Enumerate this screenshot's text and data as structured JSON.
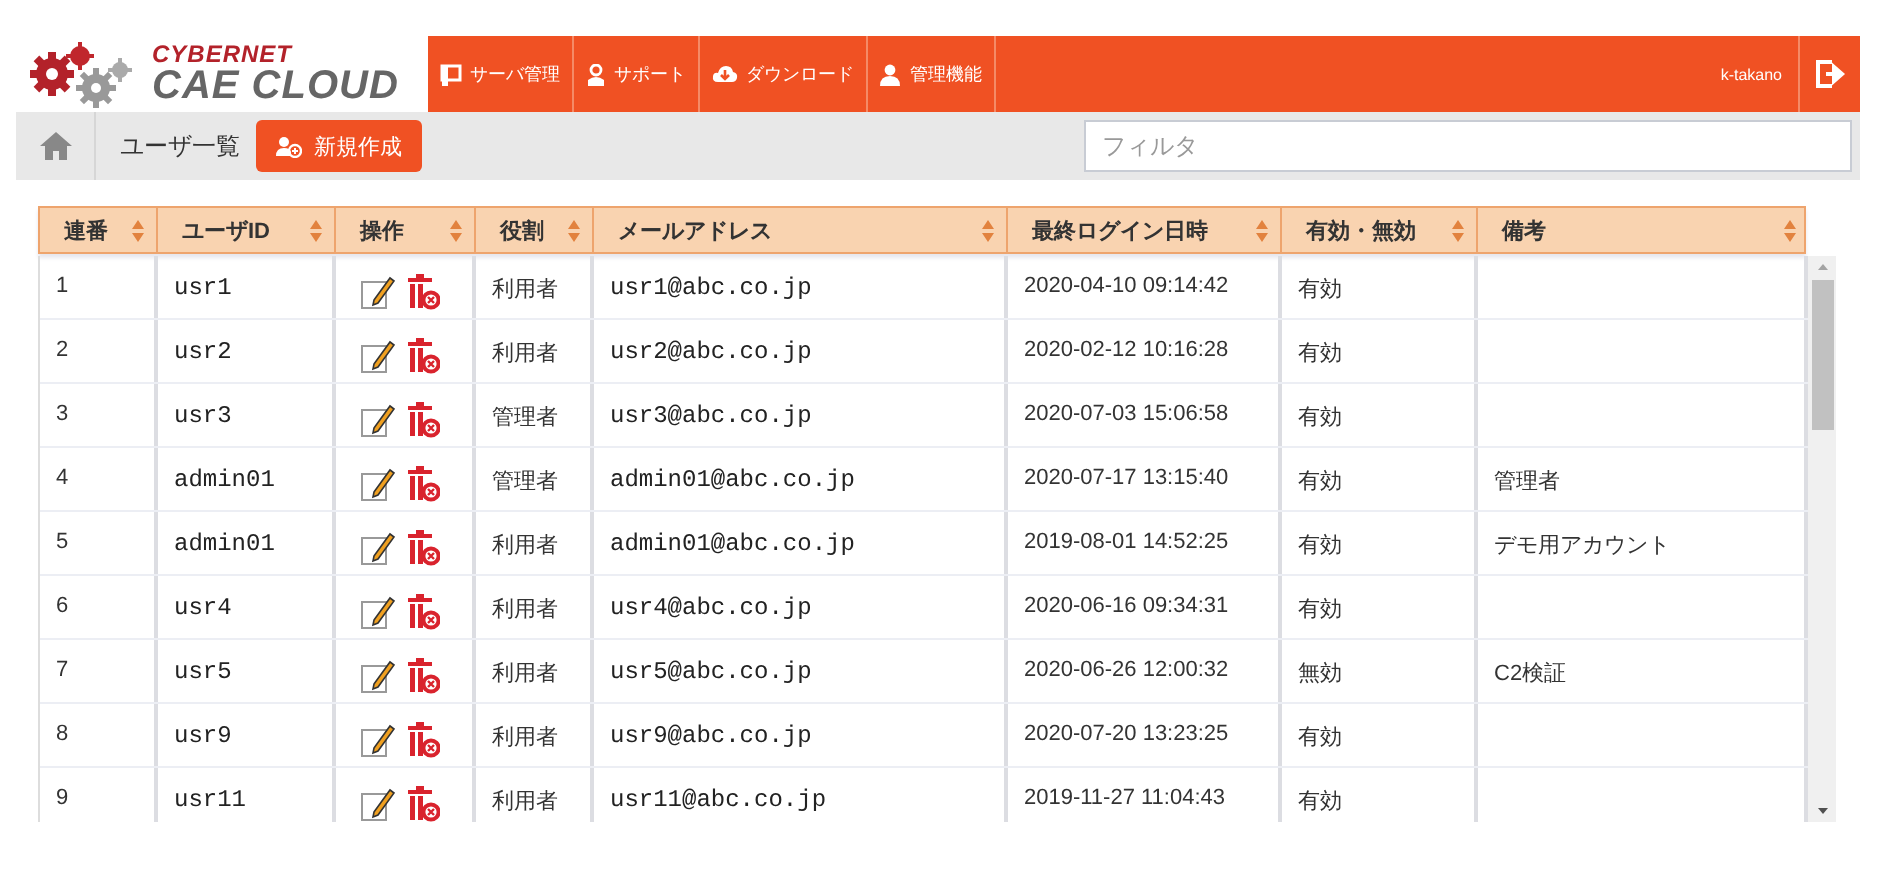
{
  "logo": {
    "line1": "CYBERNET",
    "line2": "CAE CLOUD"
  },
  "nav": [
    {
      "kind": "server",
      "label": "サーバ管理"
    },
    {
      "kind": "support",
      "label": "サポート"
    },
    {
      "kind": "download",
      "label": "ダウンロード"
    },
    {
      "kind": "admin",
      "label": "管理機能"
    }
  ],
  "user": "k-takano",
  "toolbar": {
    "breadcrumb": "ユーザ一覧",
    "new_button": "新規作成",
    "filter": {
      "placeholder": "フィルタ"
    }
  },
  "table": {
    "columns": [
      "連番",
      "ユーザID",
      "操作",
      "役割",
      "メールアドレス",
      "最終ログイン日時",
      "有効・無効",
      "備考"
    ],
    "rows": [
      {
        "no": "1",
        "user_id": "usr1",
        "role": "利用者",
        "email": "usr1@abc.co.jp",
        "last_login": "2020-04-10 09:14:42",
        "status": "有効",
        "note": ""
      },
      {
        "no": "2",
        "user_id": "usr2",
        "role": "利用者",
        "email": "usr2@abc.co.jp",
        "last_login": "2020-02-12 10:16:28",
        "status": "有効",
        "note": ""
      },
      {
        "no": "3",
        "user_id": "usr3",
        "role": "管理者",
        "email": "usr3@abc.co.jp",
        "last_login": "2020-07-03 15:06:58",
        "status": "有効",
        "note": ""
      },
      {
        "no": "4",
        "user_id": "admin01",
        "role": "管理者",
        "email": "admin01@abc.co.jp",
        "last_login": "2020-07-17 13:15:40",
        "status": "有効",
        "note": "管理者"
      },
      {
        "no": "5",
        "user_id": "admin01",
        "role": "利用者",
        "email": "admin01@abc.co.jp",
        "last_login": "2019-08-01 14:52:25",
        "status": "有効",
        "note": "デモ用アカウント"
      },
      {
        "no": "6",
        "user_id": "usr4",
        "role": "利用者",
        "email": "usr4@abc.co.jp",
        "last_login": "2020-06-16 09:34:31",
        "status": "有効",
        "note": ""
      },
      {
        "no": "7",
        "user_id": "usr5",
        "role": "利用者",
        "email": "usr5@abc.co.jp",
        "last_login": "2020-06-26 12:00:32",
        "status": "無効",
        "note": "C2検証"
      },
      {
        "no": "8",
        "user_id": "usr9",
        "role": "利用者",
        "email": "usr9@abc.co.jp",
        "last_login": "2020-07-20 13:23:25",
        "status": "有効",
        "note": ""
      },
      {
        "no": "9",
        "user_id": "usr11",
        "role": "利用者",
        "email": "usr11@abc.co.jp",
        "last_login": "2019-11-27 11:04:43",
        "status": "有効",
        "note": ""
      }
    ]
  }
}
